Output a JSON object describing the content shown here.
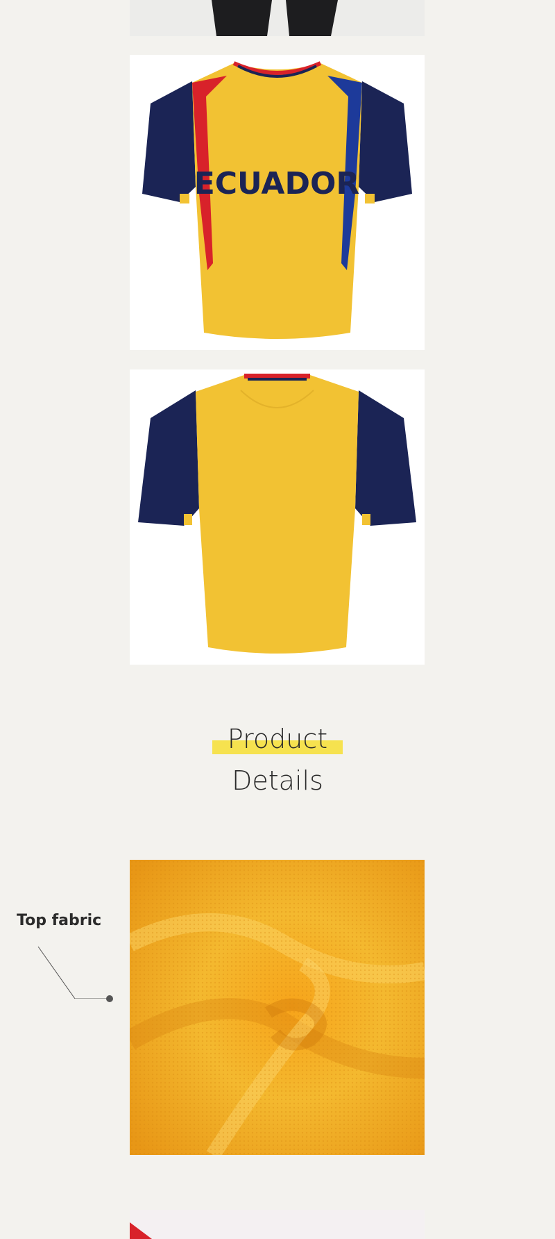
{
  "images": {
    "top_crop": "pants-photo-crop",
    "front": "jersey-front-photo",
    "back": "jersey-back-photo",
    "fabric": "mesh-fabric-photo",
    "bottom_crop": "next-photo-crop"
  },
  "jersey": {
    "chest_text": "ECUADOR",
    "colors": {
      "body": "#f2c233",
      "sleeves": "#1b2455",
      "accent_red": "#d8222a",
      "accent_blue": "#1d3a9a"
    }
  },
  "section_title": {
    "line1": "Product",
    "line2": "Details"
  },
  "callout": {
    "label": "Top fabric"
  },
  "colors": {
    "background": "#f3f2ee",
    "highlight": "#f6e24f",
    "fabric": "#f4b328"
  }
}
